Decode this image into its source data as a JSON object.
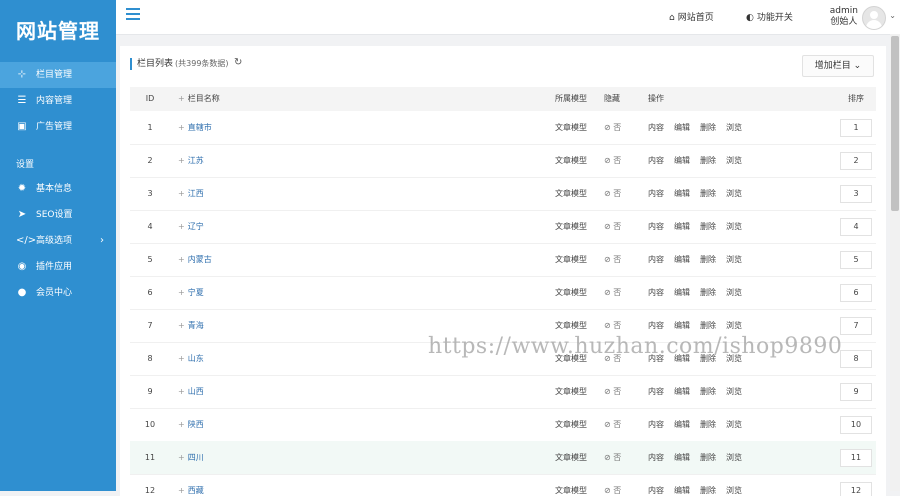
{
  "sidebar": {
    "logo": "网站管理",
    "items_top": [
      {
        "icon": "sitemap-icon",
        "glyph": "⊹",
        "label": "栏目管理",
        "active": true
      },
      {
        "icon": "list-icon",
        "glyph": "☰",
        "label": "内容管理",
        "active": false
      },
      {
        "icon": "image-icon",
        "glyph": "▣",
        "label": "广告管理",
        "active": false
      }
    ],
    "group_label": "设置",
    "items_settings": [
      {
        "icon": "gear-icon",
        "glyph": "✹",
        "label": "基本信息"
      },
      {
        "icon": "paper-plane-icon",
        "glyph": "➤",
        "label": "SEO设置"
      },
      {
        "icon": "code-icon",
        "glyph": "</>",
        "label": "高级选项",
        "has_arrow": true
      },
      {
        "icon": "plugin-icon",
        "glyph": "◉",
        "label": "插件应用"
      },
      {
        "icon": "user-icon",
        "glyph": "●",
        "label": "会员中心"
      }
    ]
  },
  "topbar": {
    "home_label": "网站首页",
    "toggle_label": "功能开关",
    "user_name": "admin",
    "user_role": "创始人"
  },
  "card": {
    "title": "栏目列表",
    "count_text": "(共399条数据)",
    "add_button": "增加栏目"
  },
  "table": {
    "headers": {
      "id": "ID",
      "name": "栏目名称",
      "model": "所属模型",
      "hidden": "隐藏",
      "ops": "操作",
      "sort": "排序"
    },
    "rows": [
      {
        "id": "1",
        "name": "直辖市",
        "model": "文章模型",
        "hidden": "⊘ 否",
        "sort": "1"
      },
      {
        "id": "2",
        "name": "江苏",
        "model": "文章模型",
        "hidden": "⊘ 否",
        "sort": "2"
      },
      {
        "id": "3",
        "name": "江西",
        "model": "文章模型",
        "hidden": "⊘ 否",
        "sort": "3"
      },
      {
        "id": "4",
        "name": "辽宁",
        "model": "文章模型",
        "hidden": "⊘ 否",
        "sort": "4"
      },
      {
        "id": "5",
        "name": "内蒙古",
        "model": "文章模型",
        "hidden": "⊘ 否",
        "sort": "5"
      },
      {
        "id": "6",
        "name": "宁夏",
        "model": "文章模型",
        "hidden": "⊘ 否",
        "sort": "6"
      },
      {
        "id": "7",
        "name": "青海",
        "model": "文章模型",
        "hidden": "⊘ 否",
        "sort": "7"
      },
      {
        "id": "8",
        "name": "山东",
        "model": "文章模型",
        "hidden": "⊘ 否",
        "sort": "8"
      },
      {
        "id": "9",
        "name": "山西",
        "model": "文章模型",
        "hidden": "⊘ 否",
        "sort": "9"
      },
      {
        "id": "10",
        "name": "陕西",
        "model": "文章模型",
        "hidden": "⊘ 否",
        "sort": "10"
      },
      {
        "id": "11",
        "name": "四川",
        "model": "文章模型",
        "hidden": "⊘ 否",
        "sort": "11",
        "highlight": true
      },
      {
        "id": "12",
        "name": "西藏",
        "model": "文章模型",
        "hidden": "⊘ 否",
        "sort": "12"
      }
    ],
    "ops": [
      "内容",
      "编辑",
      "删除",
      "浏览"
    ]
  },
  "watermark": "https://www.huzhan.com/ishop9890"
}
